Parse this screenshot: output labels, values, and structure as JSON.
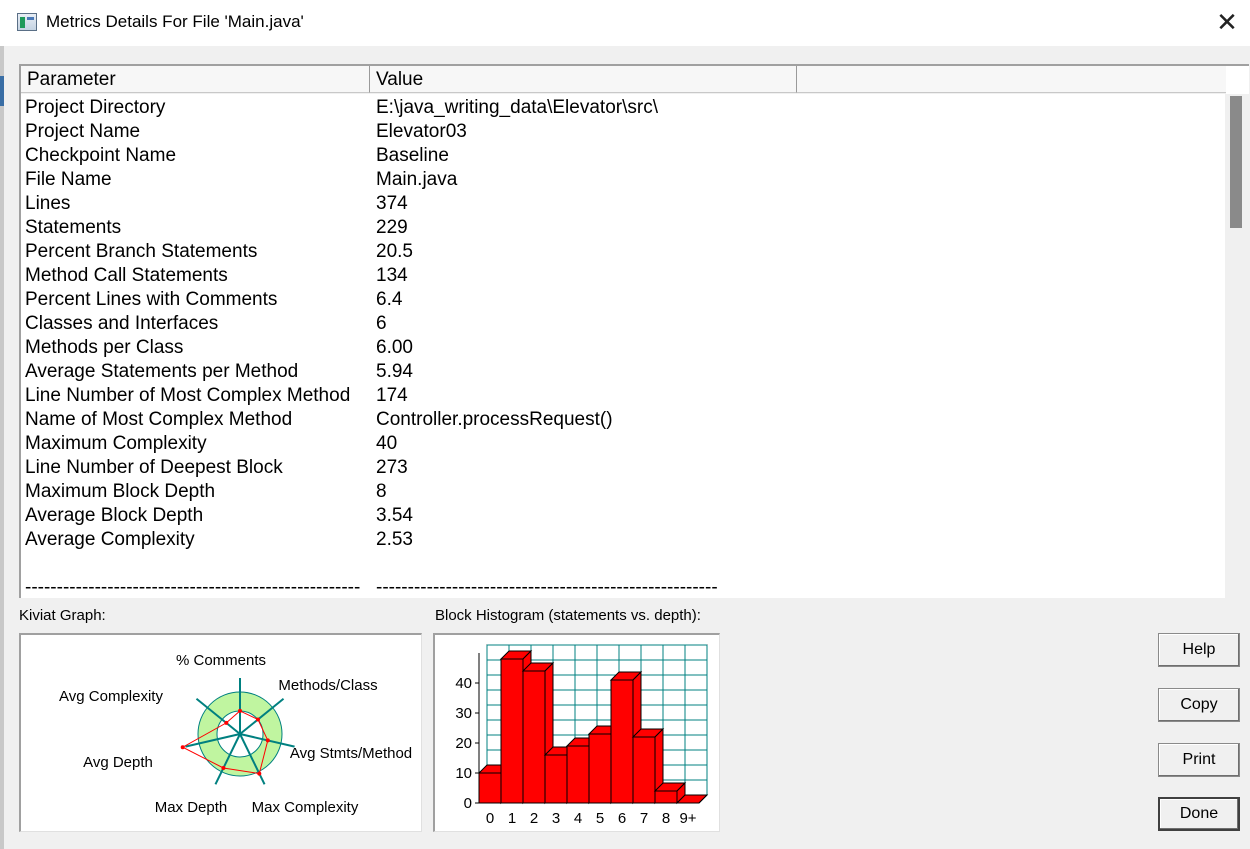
{
  "window": {
    "title": "Metrics Details For File 'Main.java'",
    "close_symbol": "✕"
  },
  "table": {
    "columns": [
      "Parameter",
      "Value"
    ],
    "rows": [
      [
        "Project Directory",
        "E:\\java_writing_data\\Elevator\\src\\"
      ],
      [
        "Project Name",
        "Elevator03"
      ],
      [
        "Checkpoint Name",
        "Baseline"
      ],
      [
        "File Name",
        "Main.java"
      ],
      [
        "Lines",
        "374"
      ],
      [
        "Statements",
        "229"
      ],
      [
        "Percent Branch Statements",
        "20.5"
      ],
      [
        "Method Call Statements",
        "134"
      ],
      [
        "Percent Lines with Comments",
        "6.4"
      ],
      [
        "Classes and Interfaces",
        "6"
      ],
      [
        "Methods per Class",
        "6.00"
      ],
      [
        "Average Statements per Method",
        "5.94"
      ],
      [
        "Line Number of Most Complex Method",
        "174"
      ],
      [
        "Name of Most Complex Method",
        "Controller.processRequest()"
      ],
      [
        "Maximum Complexity",
        "40"
      ],
      [
        "Line Number of Deepest Block",
        "273"
      ],
      [
        "Maximum Block Depth",
        "8"
      ],
      [
        "Average Block Depth",
        "3.54"
      ],
      [
        "Average Complexity",
        "2.53"
      ],
      [
        "",
        ""
      ],
      [
        "-----------------------------------------------------",
        "------------------------------------------------------"
      ]
    ]
  },
  "kiviat": {
    "label": "Kiviat Graph:",
    "axes": [
      "% Comments",
      "Methods/Class",
      "Avg Stmts/Method",
      "Max Complexity",
      "Max Depth",
      "Avg Depth",
      "Avg Complexity"
    ],
    "colors": {
      "band": "#c0f5a0",
      "axis": "#008080",
      "polygon": "#ff0000"
    }
  },
  "histogram": {
    "label": "Block Histogram (statements vs. depth):",
    "colors": {
      "bar": "#ff0000",
      "grid": "#008080"
    }
  },
  "chart_data": {
    "type": "bar",
    "categories": [
      "0",
      "1",
      "2",
      "3",
      "4",
      "5",
      "6",
      "7",
      "8",
      "9+"
    ],
    "values": [
      10,
      48,
      44,
      16,
      19,
      23,
      41,
      22,
      4,
      0
    ],
    "ylim": [
      0,
      50
    ],
    "yticks": [
      "0",
      "10",
      "20",
      "30",
      "40"
    ],
    "grid": true
  },
  "buttons": {
    "help": "Help",
    "copy": "Copy",
    "print": "Print",
    "done": "Done"
  }
}
